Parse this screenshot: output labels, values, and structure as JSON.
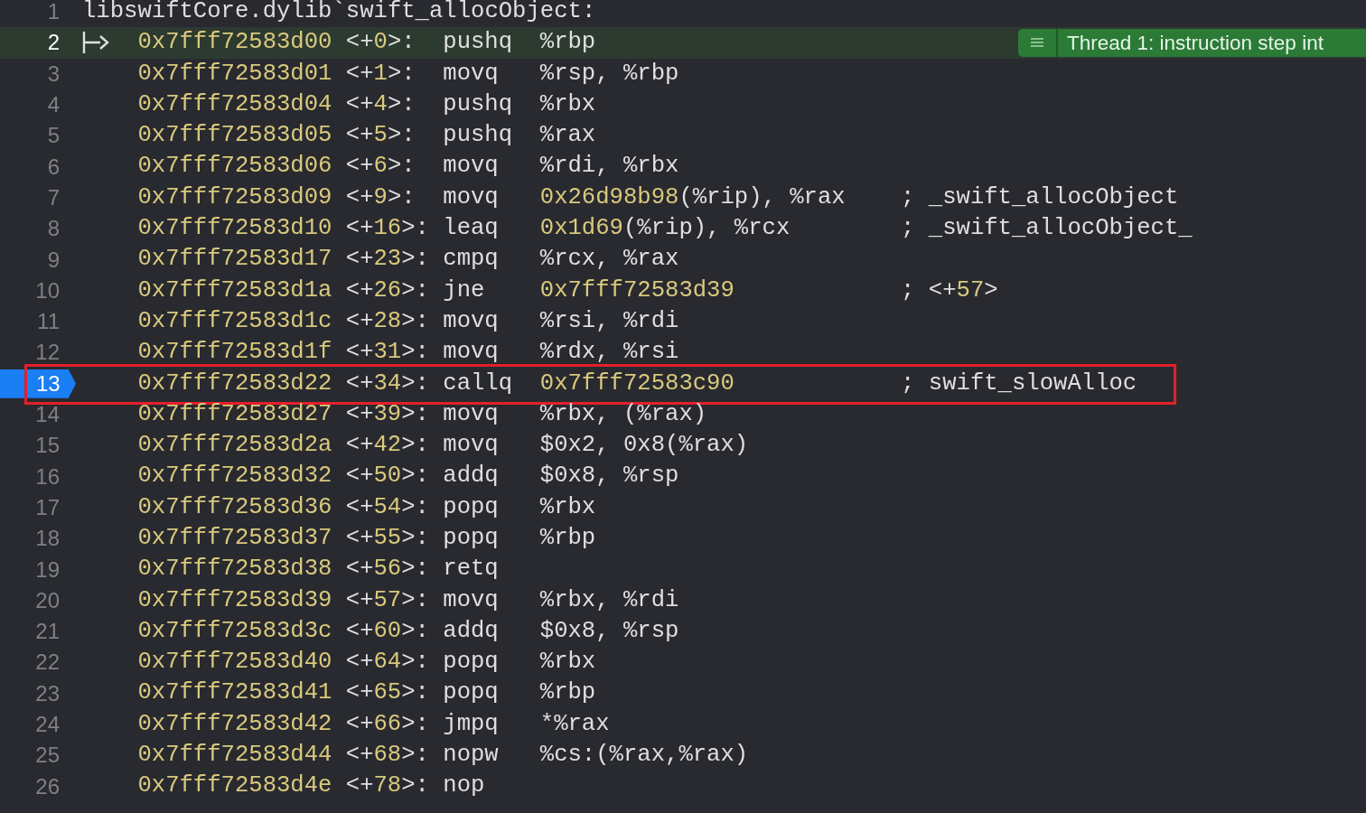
{
  "header": {
    "line": "1",
    "text": "libswiftCore.dylib`swift_allocObject:"
  },
  "thread_indicator": {
    "text": "Thread 1: instruction step int"
  },
  "rows": [
    {
      "line": "2",
      "address": "0x7fff72583d00",
      "offset": "<+0>:",
      "mnemonic": "pushq",
      "operand": "%rbp",
      "current": true,
      "breakpoint": false,
      "annotated": false
    },
    {
      "line": "3",
      "address": "0x7fff72583d01",
      "offset": "<+1>:",
      "mnemonic": "movq",
      "operand": "%rsp, %rbp",
      "current": false,
      "breakpoint": false,
      "annotated": false
    },
    {
      "line": "4",
      "address": "0x7fff72583d04",
      "offset": "<+4>:",
      "mnemonic": "pushq",
      "operand": "%rbx",
      "current": false,
      "breakpoint": false,
      "annotated": false
    },
    {
      "line": "5",
      "address": "0x7fff72583d05",
      "offset": "<+5>:",
      "mnemonic": "pushq",
      "operand": "%rax",
      "current": false,
      "breakpoint": false,
      "annotated": false
    },
    {
      "line": "6",
      "address": "0x7fff72583d06",
      "offset": "<+6>:",
      "mnemonic": "movq",
      "operand": "%rdi, %rbx",
      "current": false,
      "breakpoint": false,
      "annotated": false
    },
    {
      "line": "7",
      "address": "0x7fff72583d09",
      "offset": "<+9>:",
      "mnemonic": "movq",
      "operand": "0x26d98b98(%rip), %rax",
      "comment": "; _swift_allocObject",
      "current": false,
      "breakpoint": false,
      "annotated": false
    },
    {
      "line": "8",
      "address": "0x7fff72583d10",
      "offset": "<+16>:",
      "mnemonic": "leaq",
      "operand": "0x1d69(%rip), %rcx",
      "comment": "; _swift_allocObject_",
      "current": false,
      "breakpoint": false,
      "annotated": false
    },
    {
      "line": "9",
      "address": "0x7fff72583d17",
      "offset": "<+23>:",
      "mnemonic": "cmpq",
      "operand": "%rcx, %rax",
      "current": false,
      "breakpoint": false,
      "annotated": false
    },
    {
      "line": "10",
      "address": "0x7fff72583d1a",
      "offset": "<+26>:",
      "mnemonic": "jne",
      "operand": "0x7fff72583d39",
      "comment": "; <+57>",
      "current": false,
      "breakpoint": false,
      "annotated": false
    },
    {
      "line": "11",
      "address": "0x7fff72583d1c",
      "offset": "<+28>:",
      "mnemonic": "movq",
      "operand": "%rsi, %rdi",
      "current": false,
      "breakpoint": false,
      "annotated": false
    },
    {
      "line": "12",
      "address": "0x7fff72583d1f",
      "offset": "<+31>:",
      "mnemonic": "movq",
      "operand": "%rdx, %rsi",
      "current": false,
      "breakpoint": false,
      "annotated": false
    },
    {
      "line": "13",
      "address": "0x7fff72583d22",
      "offset": "<+34>:",
      "mnemonic": "callq",
      "operand": "0x7fff72583c90",
      "comment": "; swift_slowAlloc",
      "current": false,
      "breakpoint": true,
      "annotated": true
    },
    {
      "line": "14",
      "address": "0x7fff72583d27",
      "offset": "<+39>:",
      "mnemonic": "movq",
      "operand": "%rbx, (%rax)",
      "current": false,
      "breakpoint": false,
      "annotated": false
    },
    {
      "line": "15",
      "address": "0x7fff72583d2a",
      "offset": "<+42>:",
      "mnemonic": "movq",
      "operand": "$0x2, 0x8(%rax)",
      "current": false,
      "breakpoint": false,
      "annotated": false
    },
    {
      "line": "16",
      "address": "0x7fff72583d32",
      "offset": "<+50>:",
      "mnemonic": "addq",
      "operand": "$0x8, %rsp",
      "current": false,
      "breakpoint": false,
      "annotated": false
    },
    {
      "line": "17",
      "address": "0x7fff72583d36",
      "offset": "<+54>:",
      "mnemonic": "popq",
      "operand": "%rbx",
      "current": false,
      "breakpoint": false,
      "annotated": false
    },
    {
      "line": "18",
      "address": "0x7fff72583d37",
      "offset": "<+55>:",
      "mnemonic": "popq",
      "operand": "%rbp",
      "current": false,
      "breakpoint": false,
      "annotated": false
    },
    {
      "line": "19",
      "address": "0x7fff72583d38",
      "offset": "<+56>:",
      "mnemonic": "retq",
      "current": false,
      "breakpoint": false,
      "annotated": false
    },
    {
      "line": "20",
      "address": "0x7fff72583d39",
      "offset": "<+57>:",
      "mnemonic": "movq",
      "operand": "%rbx, %rdi",
      "current": false,
      "breakpoint": false,
      "annotated": false
    },
    {
      "line": "21",
      "address": "0x7fff72583d3c",
      "offset": "<+60>:",
      "mnemonic": "addq",
      "operand": "$0x8, %rsp",
      "current": false,
      "breakpoint": false,
      "annotated": false
    },
    {
      "line": "22",
      "address": "0x7fff72583d40",
      "offset": "<+64>:",
      "mnemonic": "popq",
      "operand": "%rbx",
      "current": false,
      "breakpoint": false,
      "annotated": false
    },
    {
      "line": "23",
      "address": "0x7fff72583d41",
      "offset": "<+65>:",
      "mnemonic": "popq",
      "operand": "%rbp",
      "current": false,
      "breakpoint": false,
      "annotated": false
    },
    {
      "line": "24",
      "address": "0x7fff72583d42",
      "offset": "<+66>:",
      "mnemonic": "jmpq",
      "operand": "*%rax",
      "current": false,
      "breakpoint": false,
      "annotated": false
    },
    {
      "line": "25",
      "address": "0x7fff72583d44",
      "offset": "<+68>:",
      "mnemonic": "nopw",
      "operand": "%cs:(%rax,%rax)",
      "current": false,
      "breakpoint": false,
      "annotated": false
    },
    {
      "line": "26",
      "address": "0x7fff72583d4e",
      "offset": "<+78>:",
      "mnemonic": "nop",
      "current": false,
      "breakpoint": false,
      "annotated": false
    }
  ]
}
